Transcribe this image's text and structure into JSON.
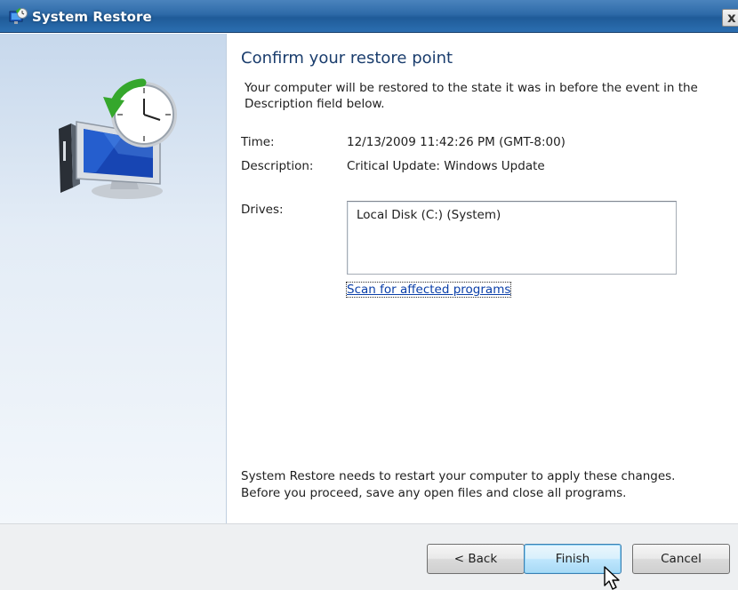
{
  "window": {
    "title": "System Restore",
    "close_label": "x",
    "icons": {
      "title": "system-restore-icon",
      "hero": "monitor-with-clock-restore-icon",
      "close": "close-icon"
    }
  },
  "page": {
    "heading": "Confirm your restore point",
    "intro": "Your computer will be restored to the state it was in before the event in the Description field below.",
    "time_label": "Time:",
    "time_value": "12/13/2009 11:42:26 PM (GMT-8:00)",
    "description_label": "Description:",
    "description_value": "Critical Update: Windows Update",
    "drives_label": "Drives:",
    "drives": [
      "Local Disk (C:) (System)"
    ],
    "scan_link": "Scan for affected programs",
    "footer_line1": "System Restore needs to restart your computer to apply these changes.",
    "footer_line2": "Before you proceed, save any open files and close all programs."
  },
  "buttons": {
    "back": "< Back",
    "finish": "Finish",
    "cancel": "Cancel"
  },
  "colors": {
    "titlebar": "#2d6aa8",
    "heading": "#1a3d6d",
    "link": "#0b3fa8",
    "left_panel": "#dce7f3",
    "button_bar": "#eef0f2"
  }
}
